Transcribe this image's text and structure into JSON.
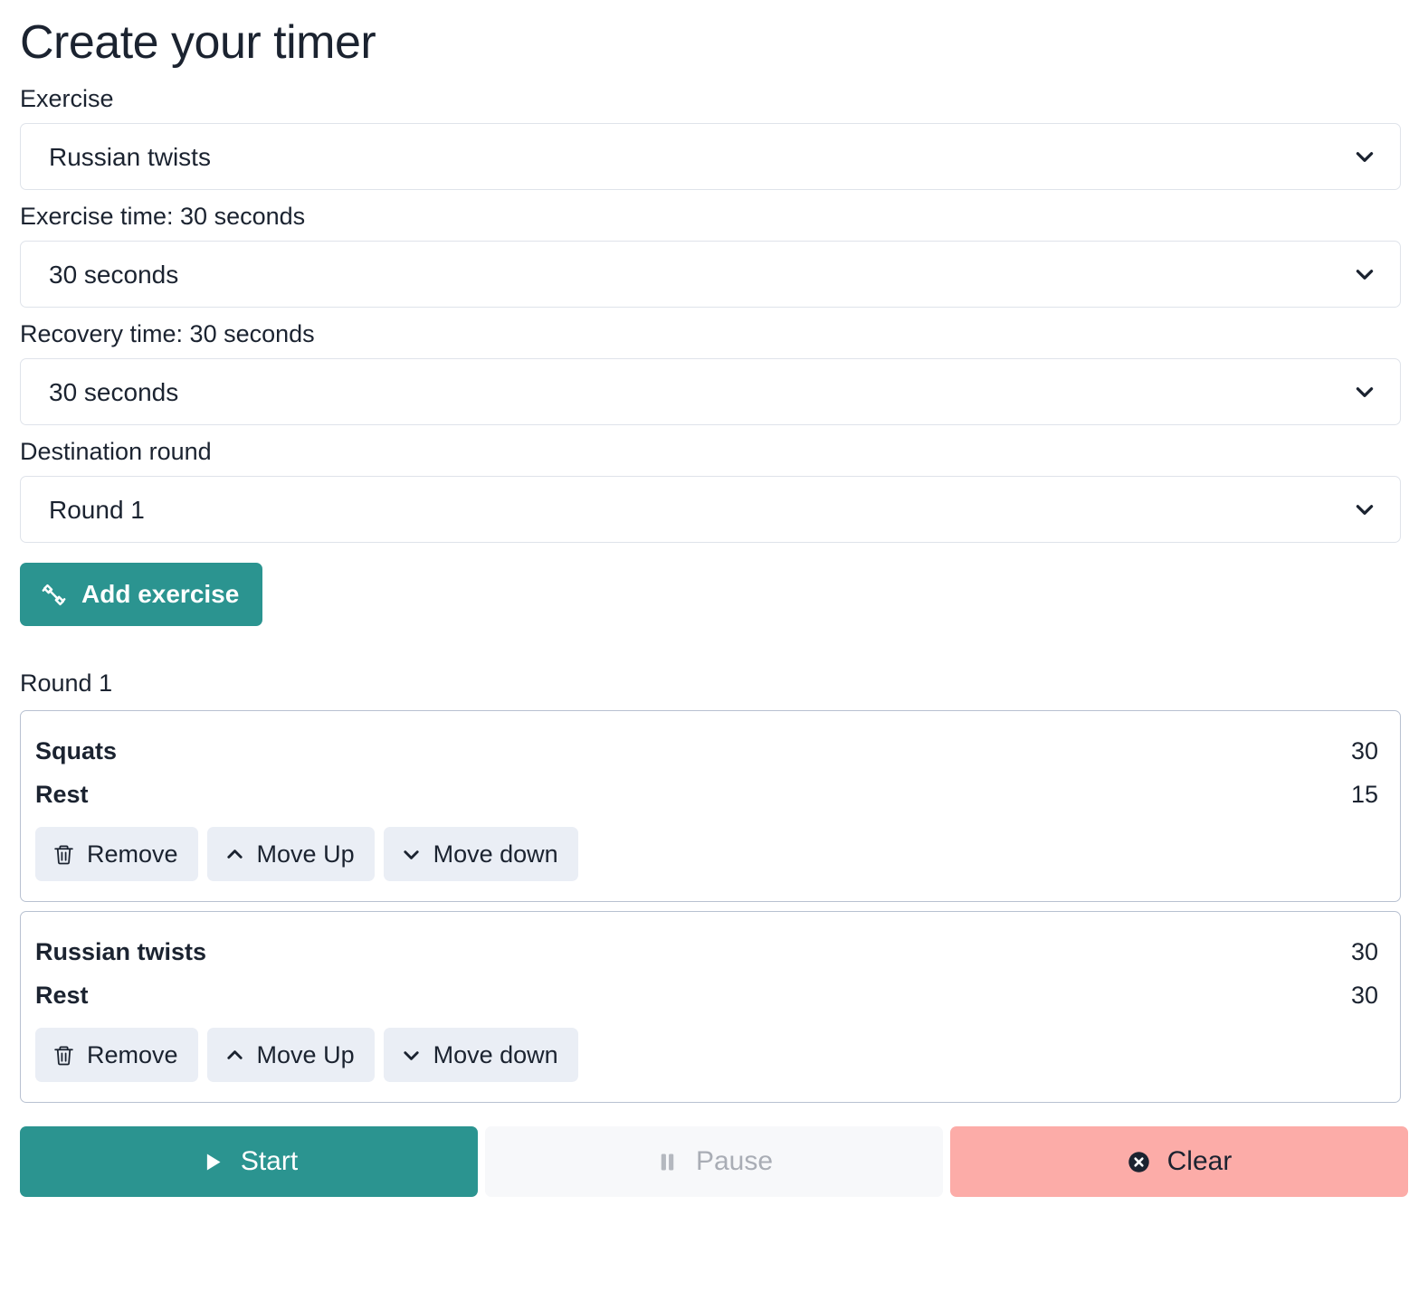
{
  "page": {
    "title": "Create your timer"
  },
  "form": {
    "exercise": {
      "label": "Exercise",
      "value": "Russian twists",
      "icon": "chevron-down-icon"
    },
    "exercise_time": {
      "label": "Exercise time: 30 seconds",
      "value": "30 seconds",
      "icon": "chevron-down-icon"
    },
    "recovery_time": {
      "label": "Recovery time: 30 seconds",
      "value": "30 seconds",
      "icon": "chevron-down-icon"
    },
    "destination_round": {
      "label": "Destination round",
      "value": "Round 1",
      "icon": "chevron-down-icon"
    },
    "add_button": {
      "label": "Add exercise",
      "icon": "dumbbell-icon"
    }
  },
  "rounds": [
    {
      "label": "Round 1",
      "exercises": [
        {
          "name": "Squats",
          "duration": "30",
          "rest_label": "Rest",
          "rest_duration": "15",
          "actions": {
            "remove": "Remove",
            "move_up": "Move Up",
            "move_down": "Move down"
          }
        },
        {
          "name": "Russian twists",
          "duration": "30",
          "rest_label": "Rest",
          "rest_duration": "30",
          "actions": {
            "remove": "Remove",
            "move_up": "Move Up",
            "move_down": "Move down"
          }
        }
      ]
    }
  ],
  "controls": {
    "start": {
      "label": "Start",
      "icon": "play-icon"
    },
    "pause": {
      "label": "Pause",
      "icon": "pause-icon",
      "disabled": true
    },
    "clear": {
      "label": "Clear",
      "icon": "x-circle-icon"
    }
  },
  "colors": {
    "accent": "#2b9490",
    "danger": "#fcaca8",
    "mini_button_bg": "#eaeef5",
    "card_border": "#b8c1d1",
    "text": "#1b2330",
    "disabled_text": "#a9adb5"
  }
}
